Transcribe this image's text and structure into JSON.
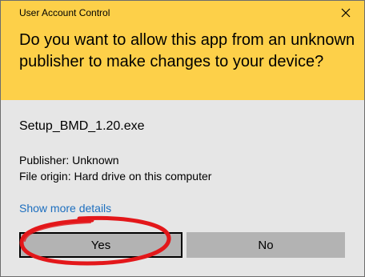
{
  "window": {
    "title": "User Account Control",
    "close_icon": "close-icon"
  },
  "prompt": {
    "question": "Do you want to allow this app from an unknown publisher to make changes to your device?"
  },
  "app": {
    "name": "Setup_BMD_1.20.exe",
    "publisher": "Publisher: Unknown",
    "file_origin": "File origin: Hard drive on this computer"
  },
  "links": {
    "show_more_details": "Show more details"
  },
  "buttons": {
    "yes": "Yes",
    "no": "No"
  },
  "colors": {
    "header_bg": "#fdd049",
    "body_bg": "#e6e6e6",
    "button_bg": "#b3b3b3",
    "link": "#1d6fbf",
    "annotation": "#e3171a"
  }
}
